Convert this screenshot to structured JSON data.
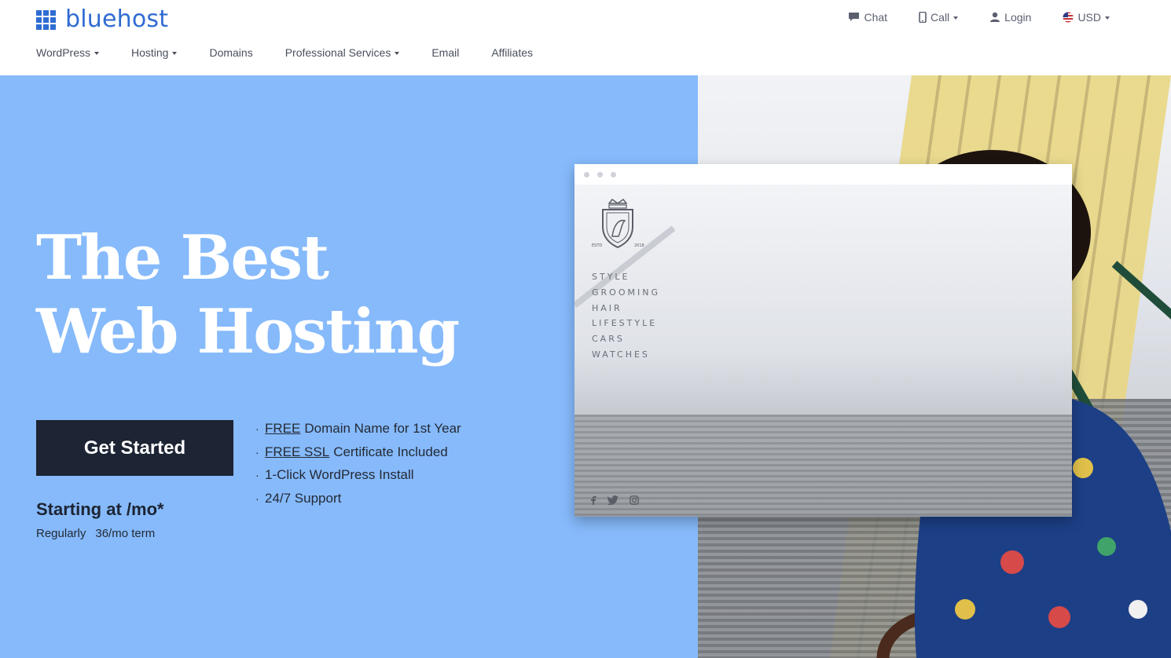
{
  "brand": {
    "name": "bluehost",
    "color": "#2f6bd2"
  },
  "utility_nav": [
    {
      "label": "Chat",
      "icon": "chat-icon",
      "dropdown": false
    },
    {
      "label": "Call",
      "icon": "phone-icon",
      "dropdown": true
    },
    {
      "label": "Login",
      "icon": "user-icon",
      "dropdown": false
    },
    {
      "label": "USD",
      "icon": "us-flag-icon",
      "dropdown": true
    }
  ],
  "main_nav": [
    {
      "label": "WordPress",
      "dropdown": true
    },
    {
      "label": "Hosting",
      "dropdown": true
    },
    {
      "label": "Domains",
      "dropdown": false
    },
    {
      "label": "Professional Services",
      "dropdown": true
    },
    {
      "label": "Email",
      "dropdown": false
    },
    {
      "label": "Affiliates",
      "dropdown": false
    }
  ],
  "hero": {
    "headline_line1": "The Best",
    "headline_line2": "Web Hosting",
    "cta_label": "Get Started",
    "features": [
      {
        "link": "FREE",
        "text": "Domain Name for 1st Year"
      },
      {
        "link": "FREE SSL",
        "text": "Certificate Included"
      },
      {
        "link": "",
        "text": "1-Click WordPress Install"
      },
      {
        "link": "",
        "text": "24/7 Support"
      }
    ],
    "price_line": "Starting at /mo*",
    "price_sub_regularly": "Regularly",
    "price_sub_term": "36/mo term",
    "background_color": "#86bafb",
    "cta_color": "#1d2433"
  },
  "mockup": {
    "crest_text_left": "ESTD",
    "crest_text_right": "2018",
    "menu": [
      "STYLE",
      "GROOMING",
      "HAIR",
      "LIFESTYLE",
      "CARS",
      "WATCHES"
    ],
    "social_icons": [
      "facebook-icon",
      "twitter-icon",
      "instagram-icon"
    ]
  }
}
